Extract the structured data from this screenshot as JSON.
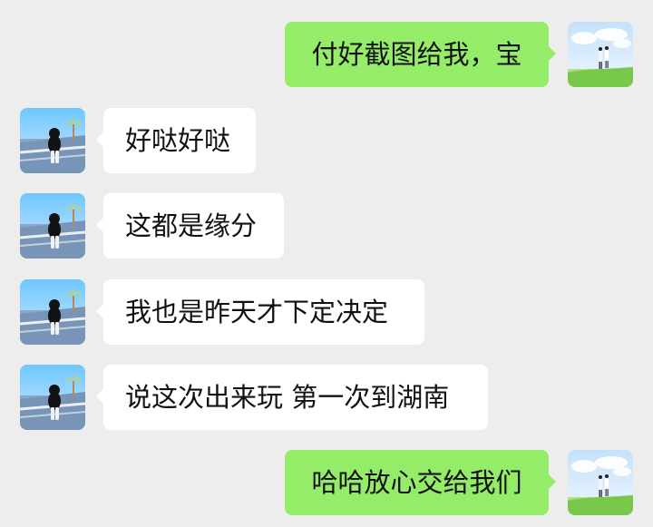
{
  "chat": {
    "messages": [
      {
        "sender": "self",
        "text": "付好截图给我，宝"
      },
      {
        "sender": "other",
        "text": "好哒好哒"
      },
      {
        "sender": "other",
        "text": "这都是缘分"
      },
      {
        "sender": "other",
        "text": "我也是昨天才下定决定"
      },
      {
        "sender": "other",
        "text": "说这次出来玩 第一次到湖南"
      },
      {
        "sender": "self",
        "text": "哈哈放心交给我们"
      }
    ]
  },
  "colors": {
    "background": "#ededed",
    "incoming_bubble": "#ffffff",
    "outgoing_bubble": "#95ec69",
    "text": "#111111"
  },
  "icons": {
    "self_avatar": "couple-landscape-avatar-icon",
    "other_avatar": "girl-back-avatar-icon"
  }
}
